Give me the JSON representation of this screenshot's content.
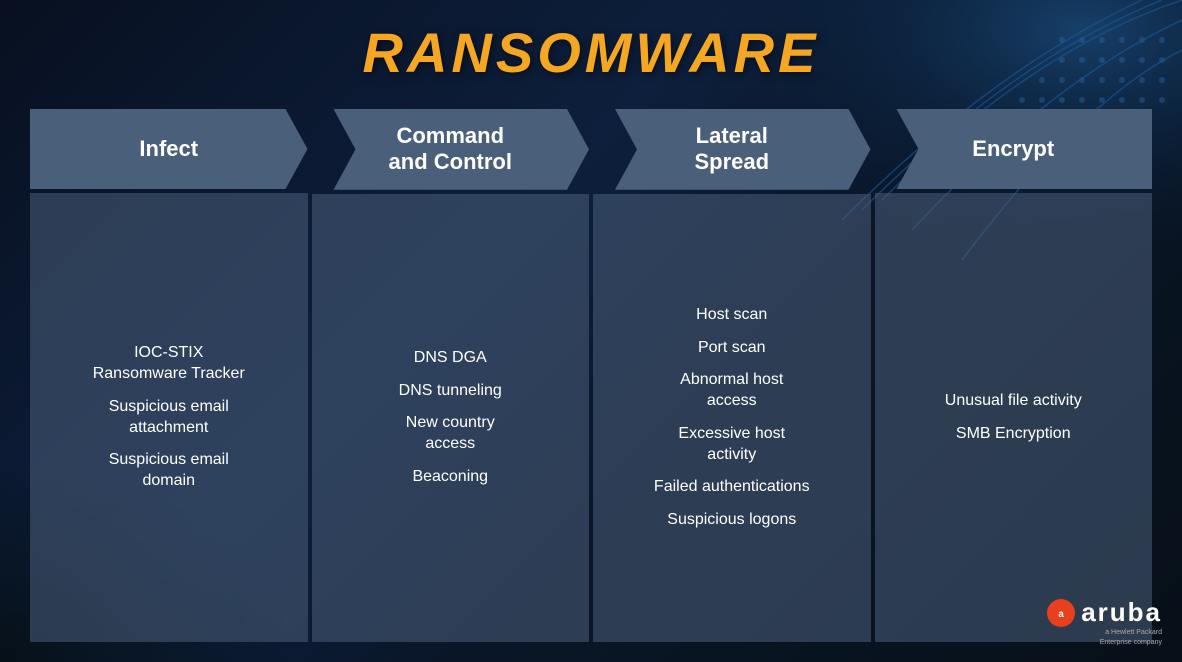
{
  "title": "RANSOMWARE",
  "columns": [
    {
      "id": "infect",
      "header": "Infect",
      "items": [
        "IOC-STIX\nRansomware Tracker",
        "Suspicious email\nattachment",
        "Suspicious email\ndomain"
      ]
    },
    {
      "id": "command-control",
      "header": "Command\nand Control",
      "items": [
        "DNS DGA",
        "DNS tunneling",
        "New country\naccess",
        "Beaconing"
      ]
    },
    {
      "id": "lateral-spread",
      "header": "Lateral\nSpread",
      "items": [
        "Host scan",
        "Port scan",
        "Abnormal host\naccess",
        "Excessive host\nactivity",
        "Failed authentications",
        "Suspicious logons"
      ]
    },
    {
      "id": "encrypt",
      "header": "Encrypt",
      "items": [
        "Unusual file activity",
        "SMB Encryption"
      ]
    }
  ],
  "logo": {
    "name": "aruba",
    "wordmark": "aruba",
    "subtext": "a Hewlett Packard\nEnterprise company"
  }
}
